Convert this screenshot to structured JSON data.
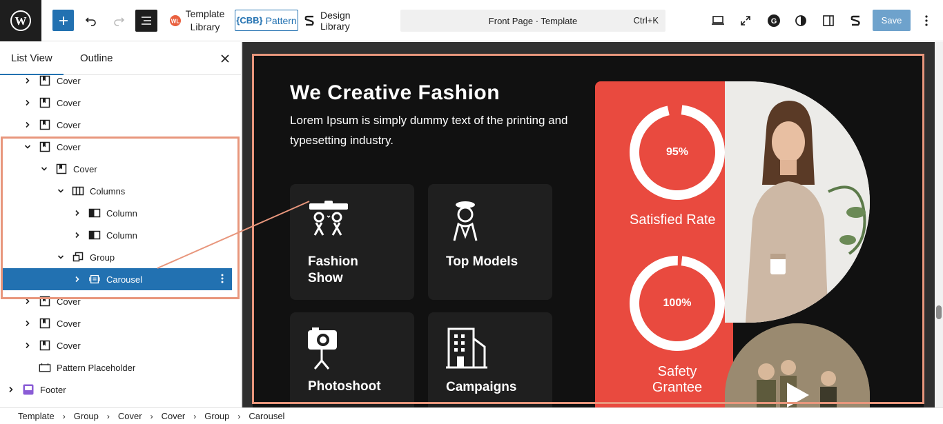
{
  "toolbar": {
    "template_library_line1": "Template",
    "template_library_line2": "Library",
    "pattern_label": "Pattern",
    "pattern_badge": "{CBB}",
    "design_library_label": "Design Library",
    "command_title": "Front Page · Template",
    "command_shortcut": "Ctrl+K",
    "save_label": "Save"
  },
  "sidebar": {
    "tabs": [
      "List View",
      "Outline"
    ],
    "items": [
      {
        "label": "Cover",
        "icon": "cover-icon",
        "depth": 0,
        "expanded": false
      },
      {
        "label": "Cover",
        "icon": "cover-icon",
        "depth": 0,
        "expanded": false
      },
      {
        "label": "Cover",
        "icon": "cover-icon",
        "depth": 0,
        "expanded": false
      },
      {
        "label": "Cover",
        "icon": "cover-icon",
        "depth": 0,
        "expanded": true
      },
      {
        "label": "Cover",
        "icon": "cover-icon",
        "depth": 1,
        "expanded": true
      },
      {
        "label": "Columns",
        "icon": "columns-icon",
        "depth": 2,
        "expanded": true
      },
      {
        "label": "Column",
        "icon": "column-icon",
        "depth": 3,
        "expanded": false
      },
      {
        "label": "Column",
        "icon": "column-icon",
        "depth": 3,
        "expanded": false
      },
      {
        "label": "Group",
        "icon": "group-icon",
        "depth": 2,
        "expanded": true
      },
      {
        "label": "Carousel",
        "icon": "carousel-icon",
        "depth": 3,
        "expanded": false,
        "selected": true
      },
      {
        "label": "Cover",
        "icon": "cover-icon",
        "depth": 0,
        "expanded": false
      },
      {
        "label": "Cover",
        "icon": "cover-icon",
        "depth": 0,
        "expanded": false
      },
      {
        "label": "Cover",
        "icon": "cover-icon",
        "depth": 0,
        "expanded": false
      },
      {
        "label": "Pattern Placeholder",
        "icon": "placeholder-icon",
        "depth": 0,
        "expanded": null
      },
      {
        "label": "Footer",
        "icon": "footer-icon",
        "depth": -1,
        "expanded": false
      }
    ]
  },
  "canvas": {
    "title": "We Creative Fashion",
    "subtitle": "Lorem Ipsum is simply dummy text of the printing and typesetting industry.",
    "cards": [
      {
        "label": "Fashion Show",
        "icon": "fashion-show-icon"
      },
      {
        "label": "Top Models",
        "icon": "top-models-icon"
      },
      {
        "label": "Photoshoot",
        "icon": "camera-icon"
      },
      {
        "label": "Campaigns",
        "icon": "building-icon"
      }
    ],
    "stats": [
      {
        "percent": "95%",
        "label": "Satisfied Rate",
        "value": 0.95
      },
      {
        "percent": "100%",
        "label": "Safety Grantee",
        "value": 1.0
      }
    ]
  },
  "breadcrumb": [
    "Template",
    "Group",
    "Cover",
    "Cover",
    "Group",
    "Carousel"
  ],
  "colors": {
    "accent": "#2271b1",
    "highlight": "#e8967c",
    "stat_red": "#e94a3f",
    "dark_bg": "#111111"
  }
}
